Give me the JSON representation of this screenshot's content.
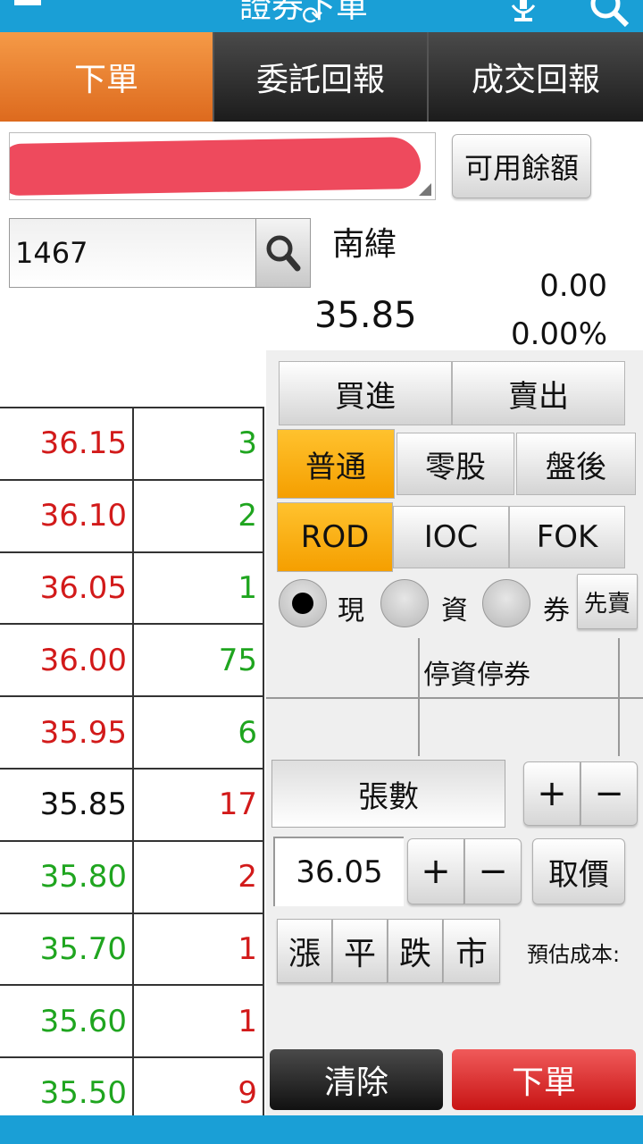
{
  "header": {
    "title": "證券下單"
  },
  "tabs": [
    {
      "label": "下單",
      "active": true
    },
    {
      "label": "委託回報",
      "active": false
    },
    {
      "label": "成交回報",
      "active": false
    }
  ],
  "account": {
    "available_balance_label": "可用餘額"
  },
  "symbol": {
    "code": "1467",
    "name": "南緯",
    "price": "35.85",
    "change": "0.00",
    "change_pct": "0.00%"
  },
  "order_book": [
    {
      "price": "36.15",
      "qty": "3",
      "price_color": "#d21a1a",
      "qty_color": "#1fa51f"
    },
    {
      "price": "36.10",
      "qty": "2",
      "price_color": "#d21a1a",
      "qty_color": "#1fa51f"
    },
    {
      "price": "36.05",
      "qty": "1",
      "price_color": "#d21a1a",
      "qty_color": "#1fa51f"
    },
    {
      "price": "36.00",
      "qty": "75",
      "price_color": "#d21a1a",
      "qty_color": "#1fa51f"
    },
    {
      "price": "35.95",
      "qty": "6",
      "price_color": "#d21a1a",
      "qty_color": "#1fa51f"
    },
    {
      "price": "35.85",
      "qty": "17",
      "price_color": "#111111",
      "qty_color": "#d21a1a"
    },
    {
      "price": "35.80",
      "qty": "2",
      "price_color": "#1fa51f",
      "qty_color": "#d21a1a"
    },
    {
      "price": "35.70",
      "qty": "1",
      "price_color": "#1fa51f",
      "qty_color": "#d21a1a"
    },
    {
      "price": "35.60",
      "qty": "1",
      "price_color": "#1fa51f",
      "qty_color": "#d21a1a"
    },
    {
      "price": "35.50",
      "qty": "9",
      "price_color": "#1fa51f",
      "qty_color": "#d21a1a"
    }
  ],
  "side": {
    "buy": "買進",
    "sell": "賣出"
  },
  "session": {
    "normal": "普通",
    "odd_lot": "零股",
    "after_hours": "盤後",
    "selected": "普通"
  },
  "tif": {
    "rod": "ROD",
    "ioc": "IOC",
    "fok": "FOK",
    "selected": "ROD"
  },
  "trade_type": {
    "cash": "現",
    "margin": "資",
    "short": "券",
    "sell_first": "先賣",
    "selected": "現"
  },
  "restriction": {
    "label": "停資停券"
  },
  "quantity": {
    "unit_label": "張數",
    "plus": "+",
    "minus": "−"
  },
  "price_input": {
    "value": "36.05",
    "plus": "+",
    "minus": "−",
    "fetch_label": "取價"
  },
  "quick_price": {
    "limit_up": "漲",
    "flat": "平",
    "limit_down": "跌",
    "market": "市"
  },
  "estimate": {
    "label": "預估成本:"
  },
  "actions": {
    "clear": "清除",
    "submit": "下單"
  },
  "colors": {
    "accent_blue": "#1a9fd6",
    "tab_active": "#ec7a2c",
    "seg_active": "#f9a90f",
    "buy_red": "#d21a1a",
    "sell_green": "#1fa51f"
  }
}
